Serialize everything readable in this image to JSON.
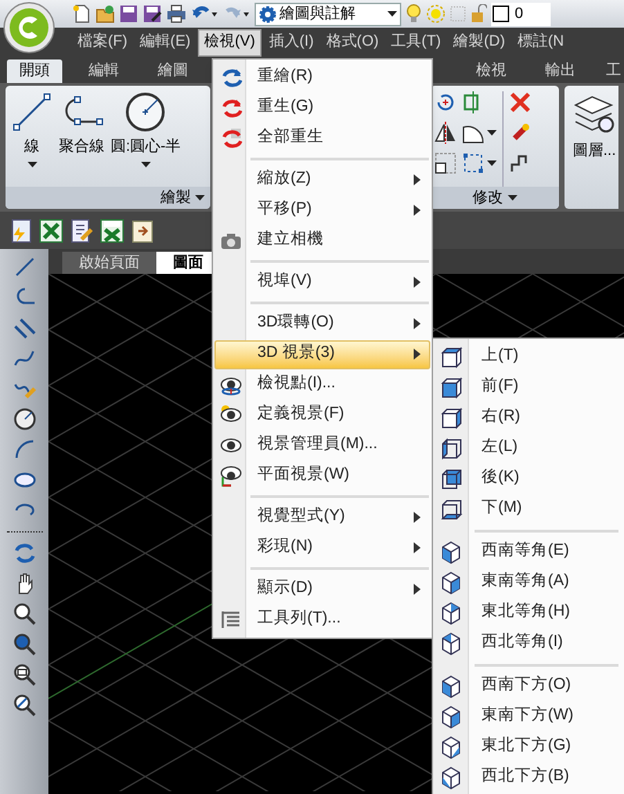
{
  "quick_access": {
    "workspace": "繪圖與註解",
    "layer": "0"
  },
  "menubar": [
    {
      "label": "檔案(F)",
      "selected": false
    },
    {
      "label": "編輯(E)",
      "selected": false
    },
    {
      "label": "檢視(V)",
      "selected": true
    },
    {
      "label": "插入(I)",
      "selected": false
    },
    {
      "label": "格式(O)",
      "selected": false
    },
    {
      "label": "工具(T)",
      "selected": false
    },
    {
      "label": "繪製(D)",
      "selected": false
    },
    {
      "label": "標註(N",
      "selected": false
    }
  ],
  "ribbon_tabs": [
    {
      "label": "開頭",
      "selected": true
    },
    {
      "label": "編輯",
      "selected": false
    },
    {
      "label": "繪圖",
      "selected": false
    },
    {
      "label": "檢視",
      "selected": false
    },
    {
      "label": "輸出",
      "selected": false
    },
    {
      "label": "工",
      "selected": false
    }
  ],
  "ribbon": {
    "draw_buttons": [
      "線",
      "聚合線",
      "圓:圓心-半"
    ],
    "draw_panel": "繪製",
    "modify_panel": "修改",
    "layer_button": "圖層..."
  },
  "document_tabs": [
    {
      "label": "啟始頁面",
      "selected": false
    },
    {
      "label": "圖面",
      "selected": true
    }
  ],
  "view_menu": {
    "groups": [
      {
        "items": [
          {
            "label": "重繪(R)",
            "submenu": false,
            "selected": false
          },
          {
            "label": "重生(G)",
            "submenu": false,
            "selected": false
          },
          {
            "label": "全部重生",
            "submenu": false,
            "selected": false
          }
        ]
      },
      {
        "items": [
          {
            "label": "縮放(Z)",
            "submenu": true,
            "selected": false
          },
          {
            "label": "平移(P)",
            "submenu": true,
            "selected": false
          },
          {
            "label": "建立相機",
            "submenu": false,
            "selected": false
          }
        ]
      },
      {
        "items": [
          {
            "label": "視埠(V)",
            "submenu": true,
            "selected": false
          }
        ]
      },
      {
        "items": [
          {
            "label": "3D環轉(O)",
            "submenu": true,
            "selected": false
          },
          {
            "label": "3D 視景(3)",
            "submenu": true,
            "selected": true
          },
          {
            "label": "檢視點(I)...",
            "submenu": false,
            "selected": false
          },
          {
            "label": "定義視景(F)",
            "submenu": false,
            "selected": false
          },
          {
            "label": "視景管理員(M)...",
            "submenu": false,
            "selected": false
          },
          {
            "label": "平面視景(W)",
            "submenu": false,
            "selected": false
          }
        ]
      },
      {
        "items": [
          {
            "label": "視覺型式(Y)",
            "submenu": true,
            "selected": false
          },
          {
            "label": "彩現(N)",
            "submenu": true,
            "selected": false
          }
        ]
      },
      {
        "items": [
          {
            "label": "顯示(D)",
            "submenu": true,
            "selected": false
          },
          {
            "label": "工具列(T)...",
            "submenu": false,
            "selected": false
          }
        ]
      }
    ]
  },
  "views_submenu": {
    "groups": [
      {
        "items": [
          "上(T)",
          "前(F)",
          "右(R)",
          "左(L)",
          "後(K)",
          "下(M)"
        ]
      },
      {
        "items": [
          "西南等角(E)",
          "東南等角(A)",
          "東北等角(H)",
          "西北等角(I)"
        ]
      },
      {
        "items": [
          "西南下方(O)",
          "東南下方(W)",
          "東北下方(G)",
          "西北下方(B)"
        ]
      }
    ]
  }
}
